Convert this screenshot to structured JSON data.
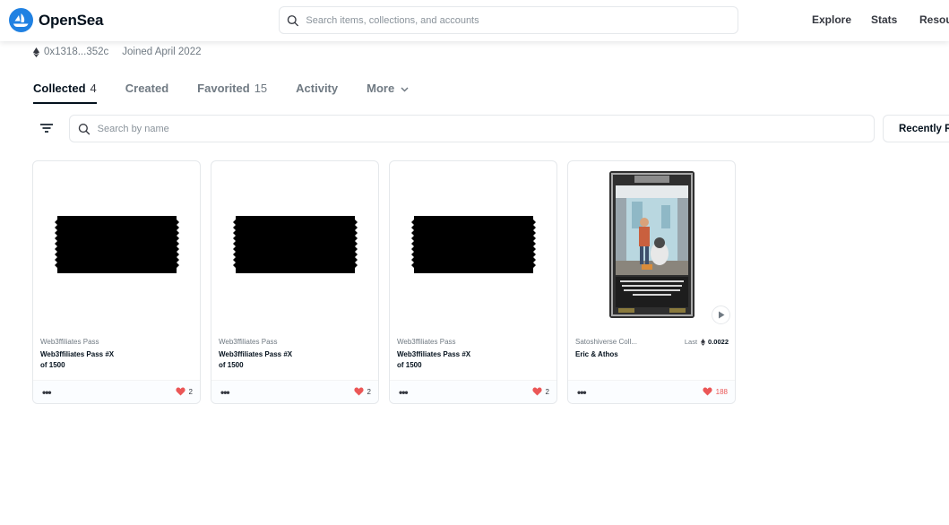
{
  "header": {
    "brand": "OpenSea",
    "search_placeholder": "Search items, collections, and accounts",
    "nav": [
      "Explore",
      "Stats",
      "Resou"
    ]
  },
  "profile": {
    "address": "0x1318...352c",
    "joined": "Joined April 2022"
  },
  "tabs": [
    {
      "label": "Collected",
      "count": "4"
    },
    {
      "label": "Created",
      "count": ""
    },
    {
      "label": "Favorited",
      "count": "15"
    },
    {
      "label": "Activity",
      "count": ""
    },
    {
      "label": "More",
      "count": ""
    }
  ],
  "filters": {
    "search_placeholder": "Search by name",
    "sort_label": "Recently R"
  },
  "cards": [
    {
      "collection": "Web3ffiliates Pass",
      "name_line1": "Web3ffiliates Pass #X",
      "name_line2": "of 1500",
      "likes": "2"
    },
    {
      "collection": "Web3ffiliates Pass",
      "name_line1": "Web3ffiliates Pass #X",
      "name_line2": "of 1500",
      "likes": "2"
    },
    {
      "collection": "Web3ffiliates Pass",
      "name_line1": "Web3ffiliates Pass #X",
      "name_line2": "of 1500",
      "likes": "2"
    },
    {
      "collection": "Satoshiverse Coll...",
      "name_line1": "Eric & Athos",
      "name_line2": "",
      "likes": "188",
      "last_label": "Last",
      "last_price": "0.0022"
    }
  ],
  "art_caption": "ALWAYS AT HIS SISTER'S SIDE, HE AND HIS TRUSTY PET, ATHOS, FIGHT FOR FREEDOM FROM CRUELTY AND OPPRESSION",
  "colors": {
    "brand": "#2081e2",
    "heart": "#eb5757",
    "text": "#04111d",
    "muted": "#707a83"
  }
}
